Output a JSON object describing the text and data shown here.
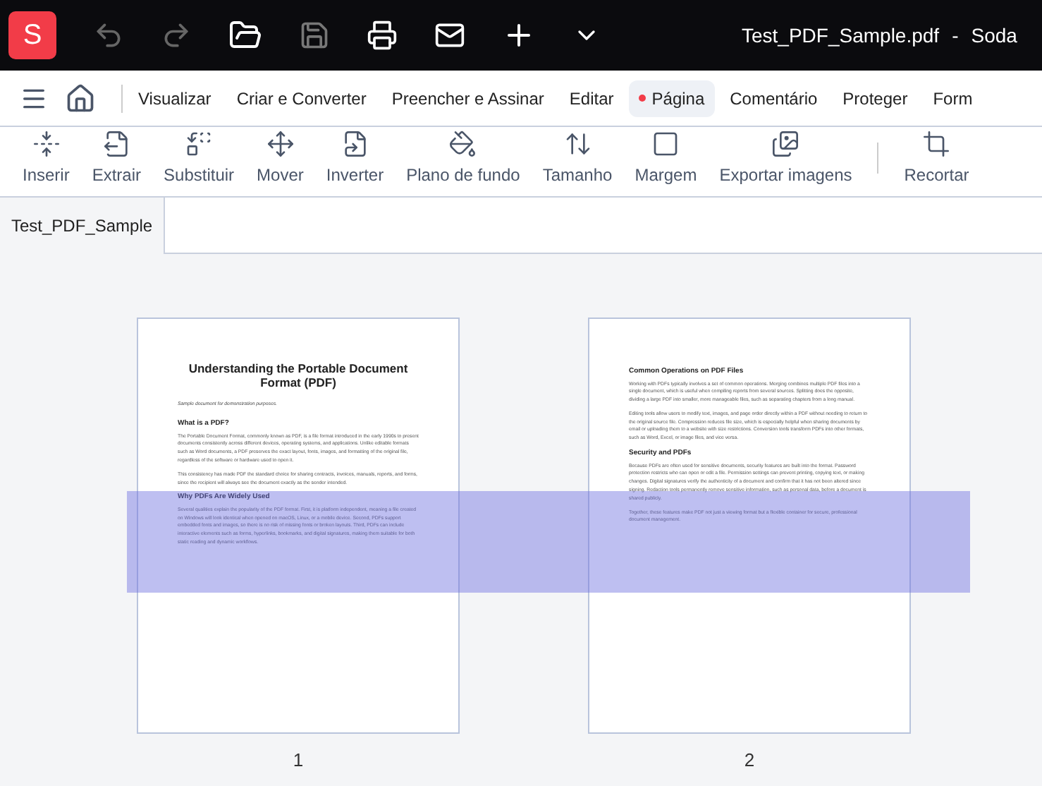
{
  "title_bar": {
    "logo": "S",
    "file_name": "Test_PDF_Sample.pdf",
    "separator": "-",
    "app_name": "Soda"
  },
  "menu": [
    {
      "label": "Visualizar",
      "selected": false
    },
    {
      "label": "Criar e Converter",
      "selected": false
    },
    {
      "label": "Preencher e Assinar",
      "selected": false
    },
    {
      "label": "Editar",
      "selected": false
    },
    {
      "label": "Página",
      "selected": true
    },
    {
      "label": "Comentário",
      "selected": false
    },
    {
      "label": "Proteger",
      "selected": false
    },
    {
      "label": "Form",
      "selected": false
    }
  ],
  "toolbar": [
    "Inserir",
    "Extrair",
    "Substituir",
    "Mover",
    "Inverter",
    "Plano de fundo",
    "Tamanho",
    "Margem",
    "Exportar imagens",
    "Recortar"
  ],
  "document_tab": {
    "label": "Test_PDF_Sample"
  },
  "pages": [
    {
      "number": "1",
      "blocks": [
        {
          "kind": "title",
          "text": "Understanding the Portable Document Format (PDF)"
        },
        {
          "kind": "note",
          "text": "Sample document for demonstration purposes."
        },
        {
          "kind": "heading",
          "text": "What is a PDF?"
        },
        {
          "kind": "paragraph",
          "text": "The Portable Document Format, commonly known as PDF, is a file format introduced in the early 1990s to present documents consistently across different devices, operating systems, and applications. Unlike editable formats such as Word documents, a PDF preserves the exact layout, fonts, images, and formatting of the original file, regardless of the software or hardware used to open it."
        },
        {
          "kind": "paragraph",
          "text": "This consistency has made PDF the standard choice for sharing contracts, invoices, manuals, reports, and forms, since the recipient will always see the document exactly as the sender intended."
        },
        {
          "kind": "heading",
          "text": "Why PDFs Are Widely Used"
        },
        {
          "kind": "paragraph",
          "text": "Several qualities explain the popularity of the PDF format. First, it is platform independent, meaning a file created on Windows will look identical when opened on macOS, Linux, or a mobile device. Second, PDFs support embedded fonts and images, so there is no risk of missing fonts or broken layouts. Third, PDFs can include interactive elements such as forms, hyperlinks, bookmarks, and digital signatures, making them suitable for both static reading and dynamic workflows."
        }
      ]
    },
    {
      "number": "2",
      "blocks": [
        {
          "kind": "heading",
          "text": "Common Operations on PDF Files"
        },
        {
          "kind": "paragraph",
          "text": "Working with PDFs typically involves a set of common operations. Merging combines multiple PDF files into a single document, which is useful when compiling reports from several sources. Splitting does the opposite, dividing a large PDF into smaller, more manageable files, such as separating chapters from a long manual."
        },
        {
          "kind": "paragraph",
          "text": "Editing tools allow users to modify text, images, and page order directly within a PDF without needing to return to the original source file. Compression reduces file size, which is especially helpful when sharing documents by email or uploading them to a website with size restrictions. Conversion tools transform PDFs into other formats, such as Word, Excel, or image files, and vice versa."
        },
        {
          "kind": "heading",
          "text": "Security and PDFs"
        },
        {
          "kind": "paragraph",
          "text": "Because PDFs are often used for sensitive documents, security features are built into the format. Password protection restricts who can open or edit a file. Permission settings can prevent printing, copying text, or making changes. Digital signatures verify the authenticity of a document and confirm that it has not been altered since signing. Redaction tools permanently remove sensitive information, such as personal data, before a document is shared publicly."
        },
        {
          "kind": "paragraph",
          "text": "Together, these features make PDF not just a viewing format but a flexible container for secure, professional document management."
        }
      ]
    }
  ]
}
